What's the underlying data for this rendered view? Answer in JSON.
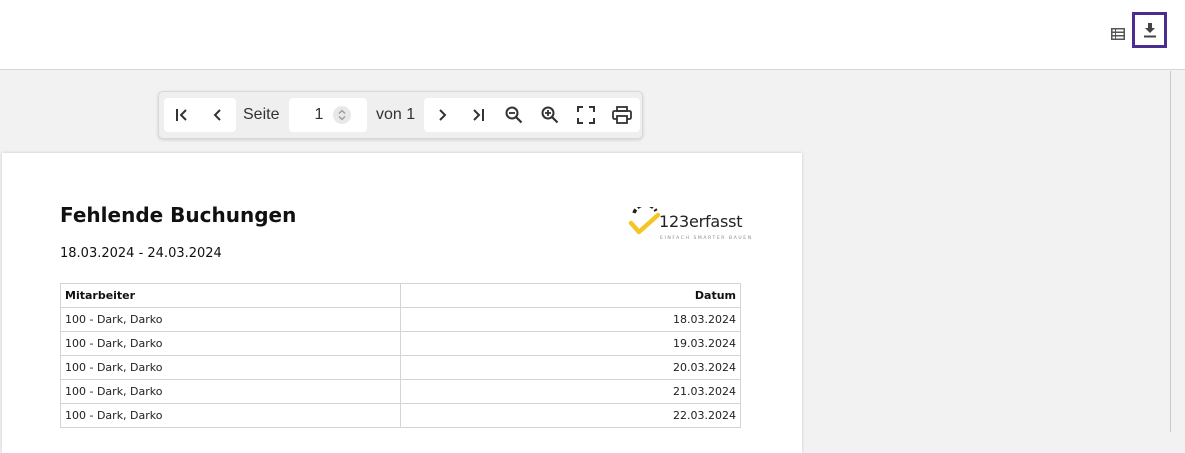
{
  "topbar": {
    "list_icon": "table-list-icon",
    "download_icon": "download-icon"
  },
  "toolbar": {
    "page_label": "Seite",
    "page_value": "1",
    "of_label": "von 1",
    "icons": [
      "first-page-icon",
      "previous-page-icon",
      "next-page-icon",
      "last-page-icon",
      "zoom-out-icon",
      "zoom-in-icon",
      "fullscreen-icon",
      "print-icon"
    ]
  },
  "document": {
    "title": "Fehlende Buchungen",
    "date_range": "18.03.2024 - 24.03.2024",
    "logo": {
      "wordmark": "123erfasst",
      "tagline": "EINFACH SMARTER BAUEN"
    },
    "table": {
      "headers": [
        "Mitarbeiter",
        "Datum"
      ],
      "rows": [
        [
          "100 - Dark, Darko",
          "18.03.2024"
        ],
        [
          "100 - Dark, Darko",
          "19.03.2024"
        ],
        [
          "100 - Dark, Darko",
          "20.03.2024"
        ],
        [
          "100 - Dark, Darko",
          "21.03.2024"
        ],
        [
          "100 - Dark, Darko",
          "22.03.2024"
        ]
      ]
    }
  },
  "colors": {
    "accent_border": "#4b2c8f",
    "logo_yellow": "#f3c623",
    "logo_dark": "#222222"
  }
}
